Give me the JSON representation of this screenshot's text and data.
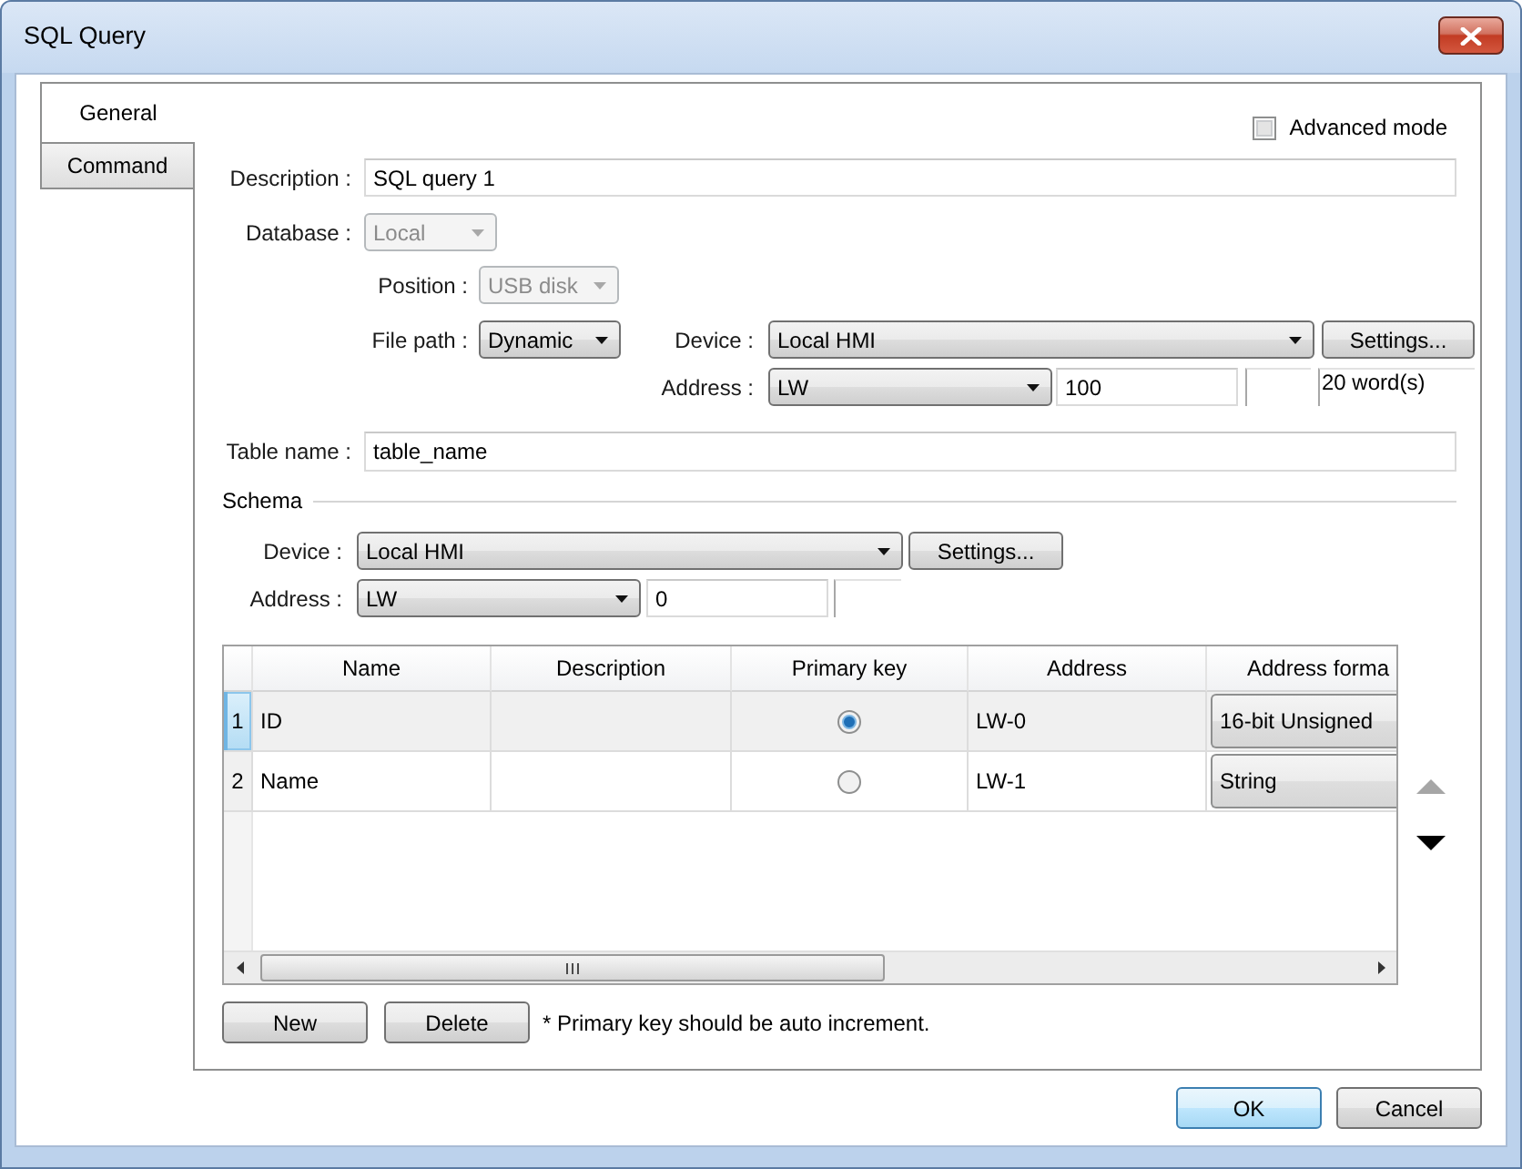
{
  "window": {
    "title": "SQL Query"
  },
  "tabs": [
    {
      "label": "General",
      "selected": true
    },
    {
      "label": "Command",
      "selected": false
    }
  ],
  "advanced_mode": {
    "label": "Advanced mode",
    "checked": false
  },
  "description": {
    "label": "Description :",
    "value": "SQL query 1"
  },
  "database": {
    "label": "Database :",
    "value": "Local",
    "disabled": true
  },
  "position": {
    "label": "Position :",
    "value": "USB disk",
    "disabled": true
  },
  "file_path": {
    "label": "File path :",
    "value": "Dynamic",
    "disabled": false
  },
  "file_device": {
    "label": "Device :",
    "value": "Local HMI",
    "button": "Settings..."
  },
  "file_address": {
    "label": "Address :",
    "type": "LW",
    "value": "100",
    "size": "20 word(s)"
  },
  "table_name": {
    "label": "Table name :",
    "value": "table_name"
  },
  "schema": {
    "title": "Schema",
    "device": {
      "label": "Device :",
      "value": "Local HMI",
      "button": "Settings..."
    },
    "address": {
      "label": "Address :",
      "type": "LW",
      "value": "0"
    }
  },
  "table": {
    "columns": [
      "Name",
      "Description",
      "Primary key",
      "Address",
      "Address forma"
    ],
    "rows": [
      {
        "number": "1",
        "name": "ID",
        "primary_key": true,
        "address": "LW-0",
        "address_format": "16-bit Unsigned",
        "selected": true
      },
      {
        "number": "2",
        "name": "Name",
        "primary_key": false,
        "address": "LW-1",
        "address_format": "String",
        "selected": false
      }
    ]
  },
  "reorder": [
    {
      "kind": "up",
      "disabled": true
    },
    {
      "kind": "down",
      "disabled": false
    }
  ],
  "buttons": [
    "New",
    "Delete"
  ],
  "note": "* Primary key should be auto increment.",
  "dialog_buttons": [
    {
      "label": "OK",
      "default": true
    },
    {
      "label": "Cancel",
      "default": false
    }
  ]
}
